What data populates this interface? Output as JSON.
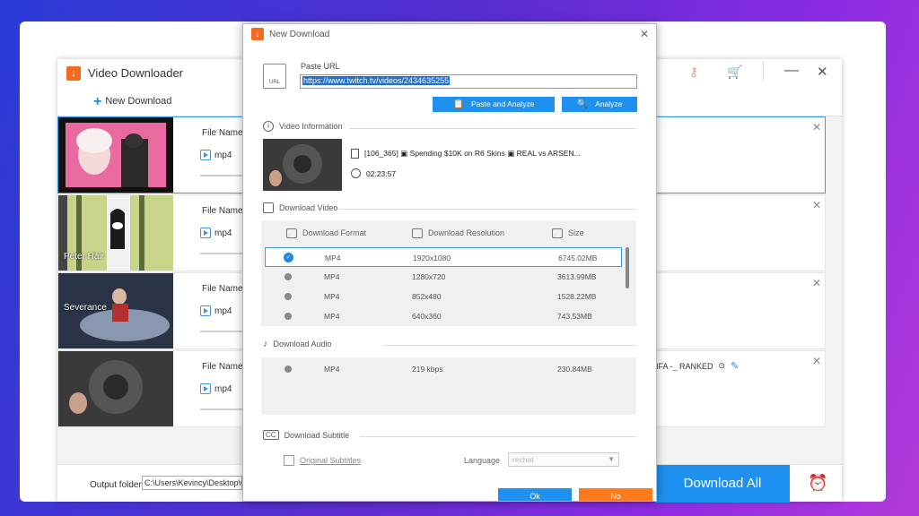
{
  "main_window": {
    "title": "Video Downloader",
    "toolbar": {
      "new_download_label": "New Download"
    },
    "rows": [
      {
        "file_name_label": "File Name:",
        "format": "mp4",
        "thumb_label": ""
      },
      {
        "file_name_label": "File Name:",
        "format": "mp4",
        "thumb_label": "Peter Hair"
      },
      {
        "file_name_label": "File Name:",
        "format": "mp4",
        "thumb_label": "Severance"
      },
      {
        "file_name_label": "File Name:",
        "format": "mp4",
        "thumb_label": "",
        "title_partial": "IFA -_ RANKED"
      }
    ],
    "output_folder_label": "Output folder:",
    "output_folder_value": "C:\\Users\\Kevincy\\Desktop\\Ou",
    "download_all_label": "Download All"
  },
  "dialog": {
    "title": "New Download",
    "paste_url_label": "Paste URL",
    "url_value": "https://www.twitch.tv/videos/2434635255",
    "paste_analyze_label": "Paste and Analyze",
    "analyze_label": "Analyze",
    "video_info_heading": "Video Information",
    "video_title": "[106_365] ▣ Spending $10K on R6 Skins ▣ REAL vs ARSEN...",
    "video_duration": "02:23:57",
    "download_video_heading": "Download Video",
    "columns": {
      "format": "Download Format",
      "resolution": "Download Resolution",
      "size": "Size"
    },
    "video_options": [
      {
        "format": "MP4",
        "resolution": "1920x1080",
        "size": "6745.02MB"
      },
      {
        "format": "MP4",
        "resolution": "1280x720",
        "size": "3613.99MB"
      },
      {
        "format": "MP4",
        "resolution": "852x480",
        "size": "1528.22MB"
      },
      {
        "format": "MP4",
        "resolution": "640x360",
        "size": "743.53MB"
      }
    ],
    "download_audio_heading": "Download Audio",
    "audio_options": [
      {
        "format": "MP4",
        "bitrate": "219 kbps",
        "size": "230.84MB"
      }
    ],
    "download_subtitle_heading": "Download Subtitle",
    "original_subtitles_label": "Original Subtitles",
    "language_label": "Language",
    "language_value": "rechat",
    "ok_label": "Ok",
    "no_label": "No"
  },
  "colors": {
    "accent": "#1e90f0",
    "no_button": "#ff7a1a",
    "logo": "#f26b21"
  }
}
